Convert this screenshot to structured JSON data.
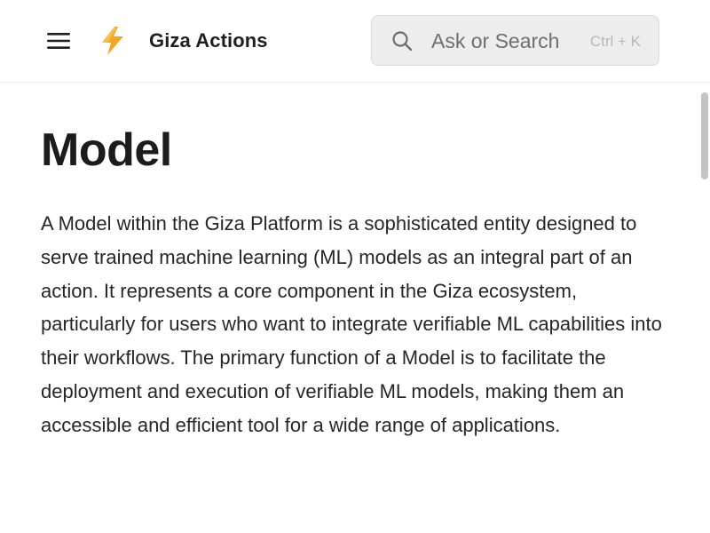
{
  "header": {
    "app_title": "Giza Actions",
    "menu_icon": "hamburger-menu-icon",
    "logo_icon": "lightning-bolt-icon",
    "logo_color": "#f5a623"
  },
  "search": {
    "placeholder": "Ask or Search",
    "shortcut": "Ctrl + K",
    "icon": "search-icon"
  },
  "main": {
    "title": "Model",
    "paragraph": "A Model within the Giza Platform is a sophisticated entity designed to serve trained machine learning (ML) models as an integral part of an action. It represents a core component in the Giza ecosystem, particularly for users who want to integrate verifiable ML capabilities into their workflows. The primary function of a Model is to facilitate the deployment and execution of verifiable ML models, making them an accessible and efficient tool for a wide range of applications."
  }
}
